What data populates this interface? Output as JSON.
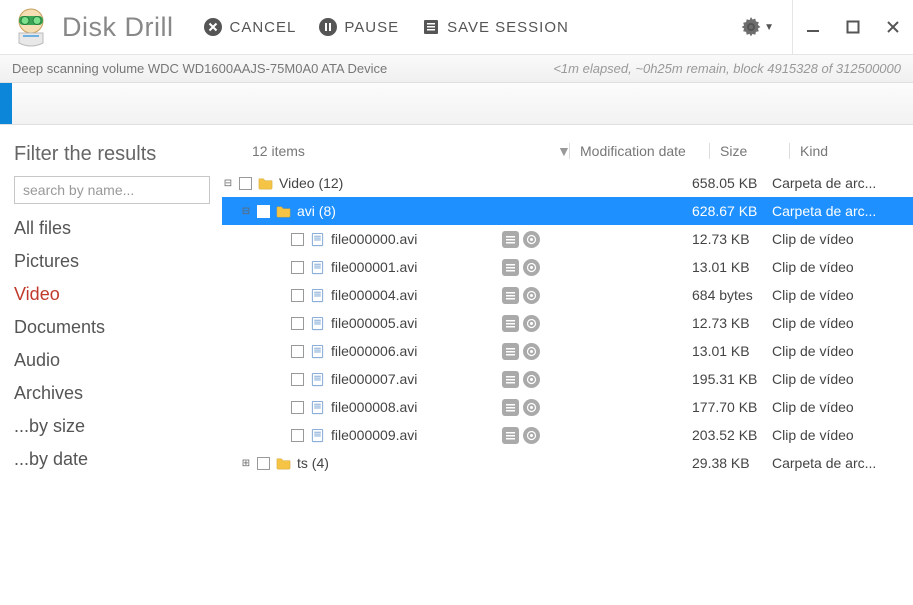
{
  "app": {
    "title": "Disk Drill"
  },
  "toolbar": {
    "cancel": "CANCEL",
    "pause": "PAUSE",
    "save_session": "SAVE SESSION"
  },
  "status": {
    "left": "Deep scanning volume WDC WD1600AAJS-75M0A0 ATA Device",
    "right": "<1m elapsed, ~0h25m remain, block 4915328 of 312500000"
  },
  "sidebar": {
    "title": "Filter the results",
    "search_placeholder": "search by name...",
    "filters": [
      "All files",
      "Pictures",
      "Video",
      "Documents",
      "Audio",
      "Archives",
      "...by size",
      "...by date"
    ],
    "active_index": 2
  },
  "columns": {
    "items": "12 items",
    "mod": "Modification date",
    "size": "Size",
    "kind": "Kind"
  },
  "tree": {
    "root": {
      "name": "Video",
      "count": "(12)",
      "size": "658.05 KB",
      "kind": "Carpeta de arc..."
    },
    "avi_folder": {
      "name": "avi",
      "count": "(8)",
      "size": "628.67 KB",
      "kind": "Carpeta de arc..."
    },
    "files": [
      {
        "name": "file000000.avi",
        "size": "12.73 KB",
        "kind": "Clip de vídeo"
      },
      {
        "name": "file000001.avi",
        "size": "13.01 KB",
        "kind": "Clip de vídeo"
      },
      {
        "name": "file000004.avi",
        "size": "684 bytes",
        "kind": "Clip de vídeo"
      },
      {
        "name": "file000005.avi",
        "size": "12.73 KB",
        "kind": "Clip de vídeo"
      },
      {
        "name": "file000006.avi",
        "size": "13.01 KB",
        "kind": "Clip de vídeo"
      },
      {
        "name": "file000007.avi",
        "size": "195.31 KB",
        "kind": "Clip de vídeo"
      },
      {
        "name": "file000008.avi",
        "size": "177.70 KB",
        "kind": "Clip de vídeo"
      },
      {
        "name": "file000009.avi",
        "size": "203.52 KB",
        "kind": "Clip de vídeo"
      }
    ],
    "ts_folder": {
      "name": "ts",
      "count": "(4)",
      "size": "29.38 KB",
      "kind": "Carpeta de arc..."
    }
  }
}
